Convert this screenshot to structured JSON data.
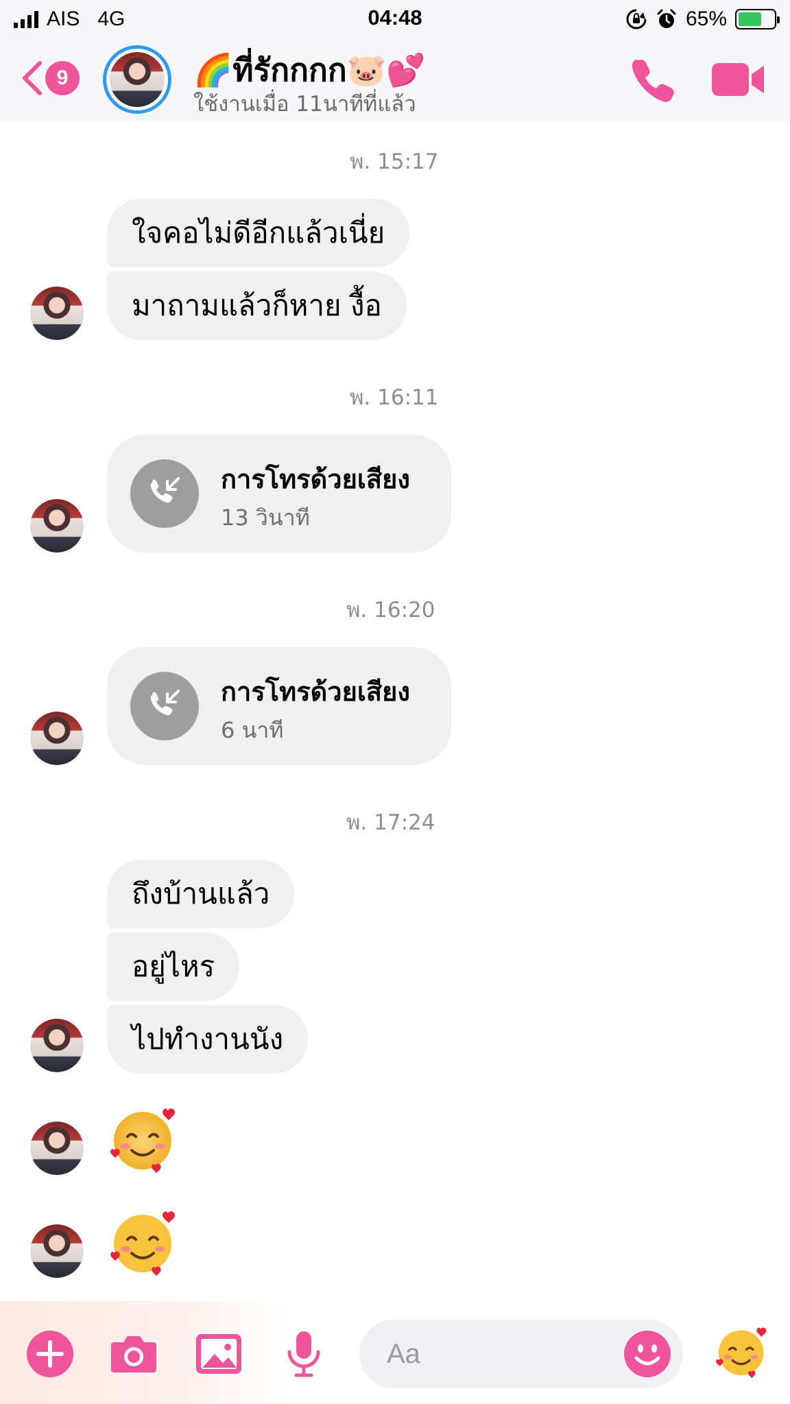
{
  "status_bar": {
    "carrier": "AIS",
    "network": "4G",
    "time": "04:48",
    "battery": "65%",
    "battery_level": 0.65
  },
  "header": {
    "back_count": "9",
    "contact_name": "🌈ที่รักกกก🐷💕",
    "active_status": "ใช้งานเมื่อ 11นาทีที่แล้ว",
    "icons": [
      "chevron-left-icon",
      "phone-icon",
      "video-camera-icon"
    ],
    "accent_color": "#f0549c"
  },
  "messages": {
    "group1": {
      "time": "พ. 15:17",
      "lines": [
        "ใจคอไม่ดีอีกแล้วเนี่ย",
        "มาถามแล้วก็หาย งื้อ"
      ]
    },
    "call1": {
      "time": "พ. 16:11",
      "title": "การโทรด้วยเสียง",
      "duration": "13 วินาที"
    },
    "call2": {
      "time": "พ. 16:20",
      "title": "การโทรด้วยเสียง",
      "duration": "6 นาที"
    },
    "group2": {
      "time": "พ. 17:24",
      "lines": [
        "ถึงบ้านแล้ว",
        "อยู่ไหร",
        "ไปทำงานนัง"
      ]
    },
    "emoji_messages": [
      "smiling-face-with-hearts",
      "smiling-face-with-hearts"
    ]
  },
  "composer": {
    "placeholder": "Aa",
    "tools": [
      "plus-icon",
      "camera-icon",
      "image-icon",
      "microphone-icon"
    ],
    "quick_reaction": "smiling-face-with-hearts"
  }
}
